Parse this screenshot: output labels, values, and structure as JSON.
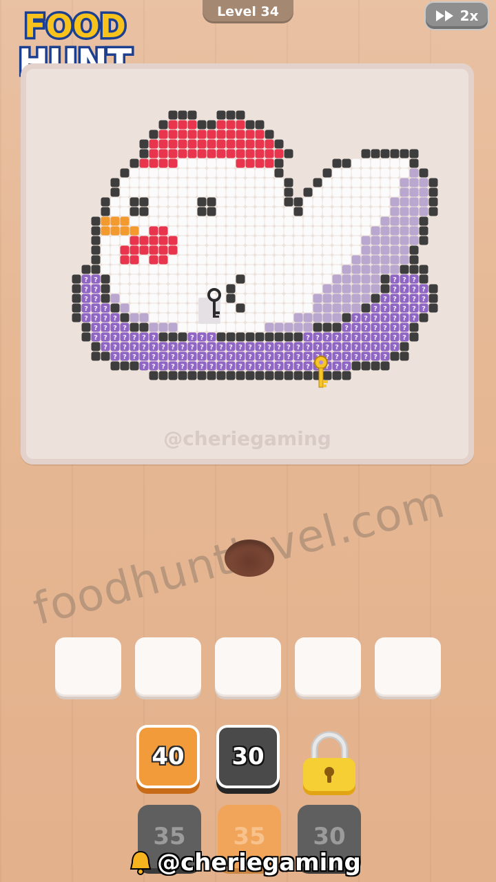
{
  "header": {
    "logo_line1": "FOOD",
    "logo_line2": "HUNT",
    "level_label": "Level 34",
    "speed_label": "2x",
    "speed_icon": "fast-forward-icon"
  },
  "board": {
    "faint_credit": "@cheriegaming",
    "picture": "pixel-art-chicken-in-nest",
    "items": [
      "key-icon",
      "gold-key-icon"
    ]
  },
  "watermark": "foodhuntlevel.com",
  "slots": {
    "count": 5,
    "values": [
      "",
      "",
      "",
      "",
      ""
    ]
  },
  "tiles_front": [
    {
      "value": "40",
      "color": "orange",
      "selectable": true
    },
    {
      "value": "30",
      "color": "dark",
      "selectable": true
    },
    {
      "value": "",
      "color": "locked",
      "icon": "padlock-icon"
    }
  ],
  "tiles_back": [
    {
      "value": "35",
      "color": "dark"
    },
    {
      "value": "35",
      "color": "orange"
    },
    {
      "value": "30",
      "color": "dark"
    }
  ],
  "credit": {
    "icon": "bell-icon",
    "text": "@cheriegaming"
  },
  "colors": {
    "orange_tile": "#f19b3a",
    "dark_tile": "#4a4a4a",
    "purple_block": "#8e64c4",
    "red_comb": "#e8344d",
    "gold_lock": "#f2c12e"
  }
}
